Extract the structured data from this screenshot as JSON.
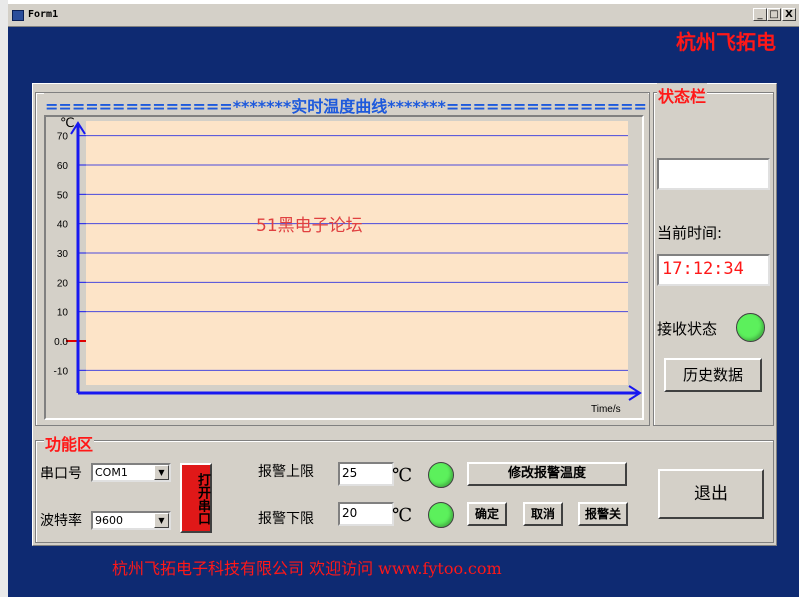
{
  "window": {
    "title": "Form1",
    "controls": {
      "minimize": "_",
      "maximize": "□",
      "close": "X"
    }
  },
  "company_top": "杭州飞拓电",
  "chart_frame": {
    "title": "==============*******实时温度曲线*******==============="
  },
  "chart_data": {
    "type": "line",
    "series": [],
    "ylim": [
      -15,
      75
    ],
    "yticks": [
      70,
      60,
      50,
      40,
      30,
      20,
      10,
      "0.0",
      -10
    ],
    "ylabel": "℃",
    "xlabel": "Time/s",
    "grid": true,
    "colors": {
      "plot_bg": "#fde4c8",
      "grid": "#4a4adc",
      "axis": "#1717f0",
      "zero_mark": "#e00000"
    }
  },
  "watermark": "51黑电子论坛",
  "status_bar": {
    "title": "状态栏",
    "status_value": "",
    "current_time_label": "当前时间:",
    "current_time": "17:12:34",
    "receive_status_label": "接收状态",
    "history_button": "历史数据"
  },
  "function_area": {
    "title": "功能区",
    "port_label": "串口号",
    "port_value": "COM1",
    "baud_label": "波特率",
    "baud_value": "9600",
    "open_port_button": "打开串口",
    "alarm_high_label": "报警上限",
    "alarm_high_value": "25",
    "alarm_low_label": "报警下限",
    "alarm_low_value": "20",
    "unit": "℃",
    "modify_alarm_button": "修改报警温度",
    "confirm_button": "确定",
    "cancel_button": "取消",
    "alarm_off_button": "报警关",
    "exit_button": "退出"
  },
  "company_bottom": "杭州飞拓电子科技有限公司    欢迎访问 www.fytoo.com"
}
